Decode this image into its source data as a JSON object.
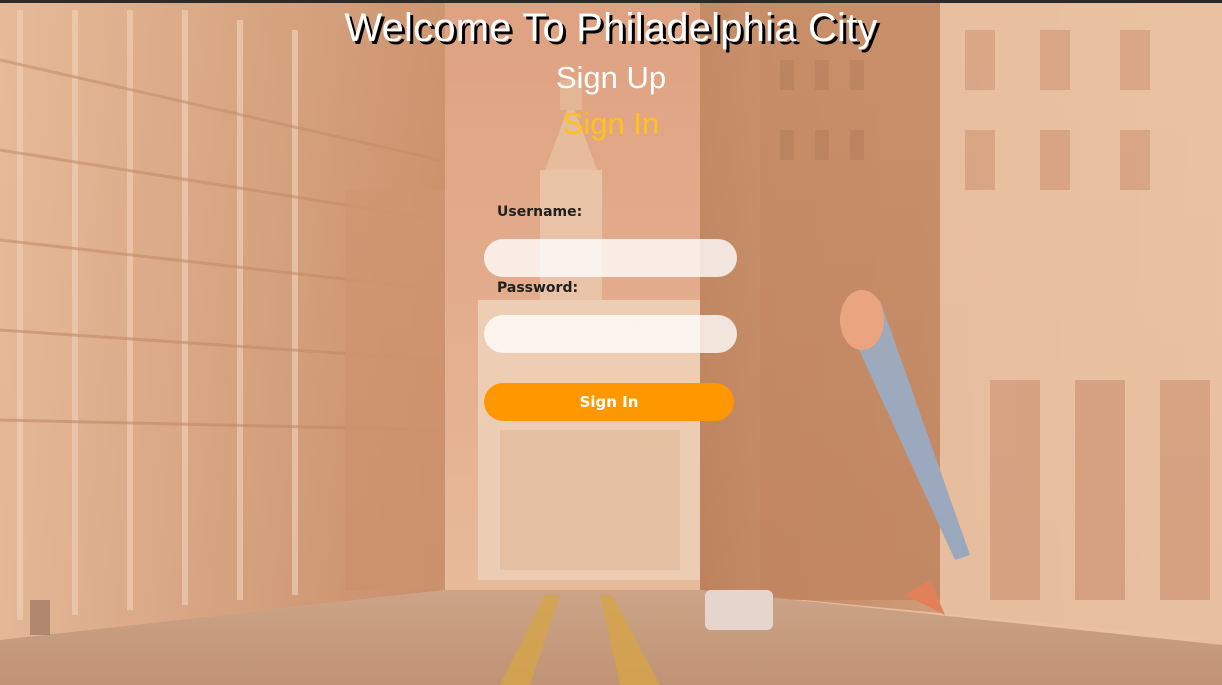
{
  "header": {
    "title": "Welcome To Philadelphia City"
  },
  "nav": {
    "sign_up": "Sign Up",
    "sign_in": "Sign In"
  },
  "form": {
    "username_label": "Username:",
    "username_value": "",
    "password_label": "Password:",
    "password_value": "",
    "submit_label": "Sign In"
  },
  "colors": {
    "accent": "#ff9800",
    "active_nav": "#ffc21a",
    "background_tint": "#c98f62"
  }
}
